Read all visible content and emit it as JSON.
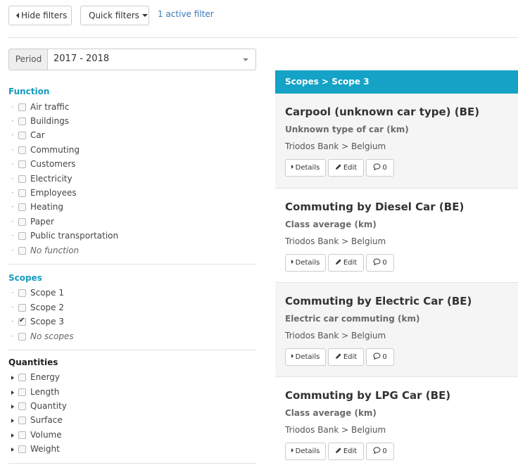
{
  "toolbar": {
    "hide_filters": "Hide filters",
    "quick_filters": "Quick filters",
    "active_filter": "1 active filter"
  },
  "period": {
    "label": "Period",
    "value": "2017 - 2018"
  },
  "filters": {
    "function": {
      "title": "Function",
      "items": [
        "Air traffic",
        "Buildings",
        "Car",
        "Commuting",
        "Customers",
        "Electricity",
        "Employees",
        "Heating",
        "Paper",
        "Public transportation"
      ],
      "none_label": "No function"
    },
    "scopes": {
      "title": "Scopes",
      "items": [
        "Scope 1",
        "Scope 2",
        "Scope 3"
      ],
      "checked": "Scope 3",
      "none_label": "No scopes"
    },
    "quantities": {
      "title": "Quantities",
      "items": [
        "Energy",
        "Length",
        "Quantity",
        "Surface",
        "Volume",
        "Weight"
      ]
    }
  },
  "results": {
    "breadcrumb": "Scopes > Scope 3",
    "cards": [
      {
        "title": "Carpool (unknown car type) (BE)",
        "subtitle": "Unknown type of car (km)",
        "org": "Triodos Bank > Belgium",
        "details": "Details",
        "edit": "Edit",
        "comments": "0"
      },
      {
        "title": "Commuting by Diesel Car (BE)",
        "subtitle": "Class average (km)",
        "org": "Triodos Bank > Belgium",
        "details": "Details",
        "edit": "Edit",
        "comments": "0"
      },
      {
        "title": "Commuting by Electric Car (BE)",
        "subtitle": "Electric car commuting (km)",
        "org": "Triodos Bank > Belgium",
        "details": "Details",
        "edit": "Edit",
        "comments": "0"
      },
      {
        "title": "Commuting by LPG Car (BE)",
        "subtitle": "Class average (km)",
        "org": "Triodos Bank > Belgium",
        "details": "Details",
        "edit": "Edit",
        "comments": "0"
      }
    ]
  },
  "colors": {
    "accent": "#14a3c7",
    "link": "#3a7ab8",
    "card_shade": "#f5f5f5"
  }
}
